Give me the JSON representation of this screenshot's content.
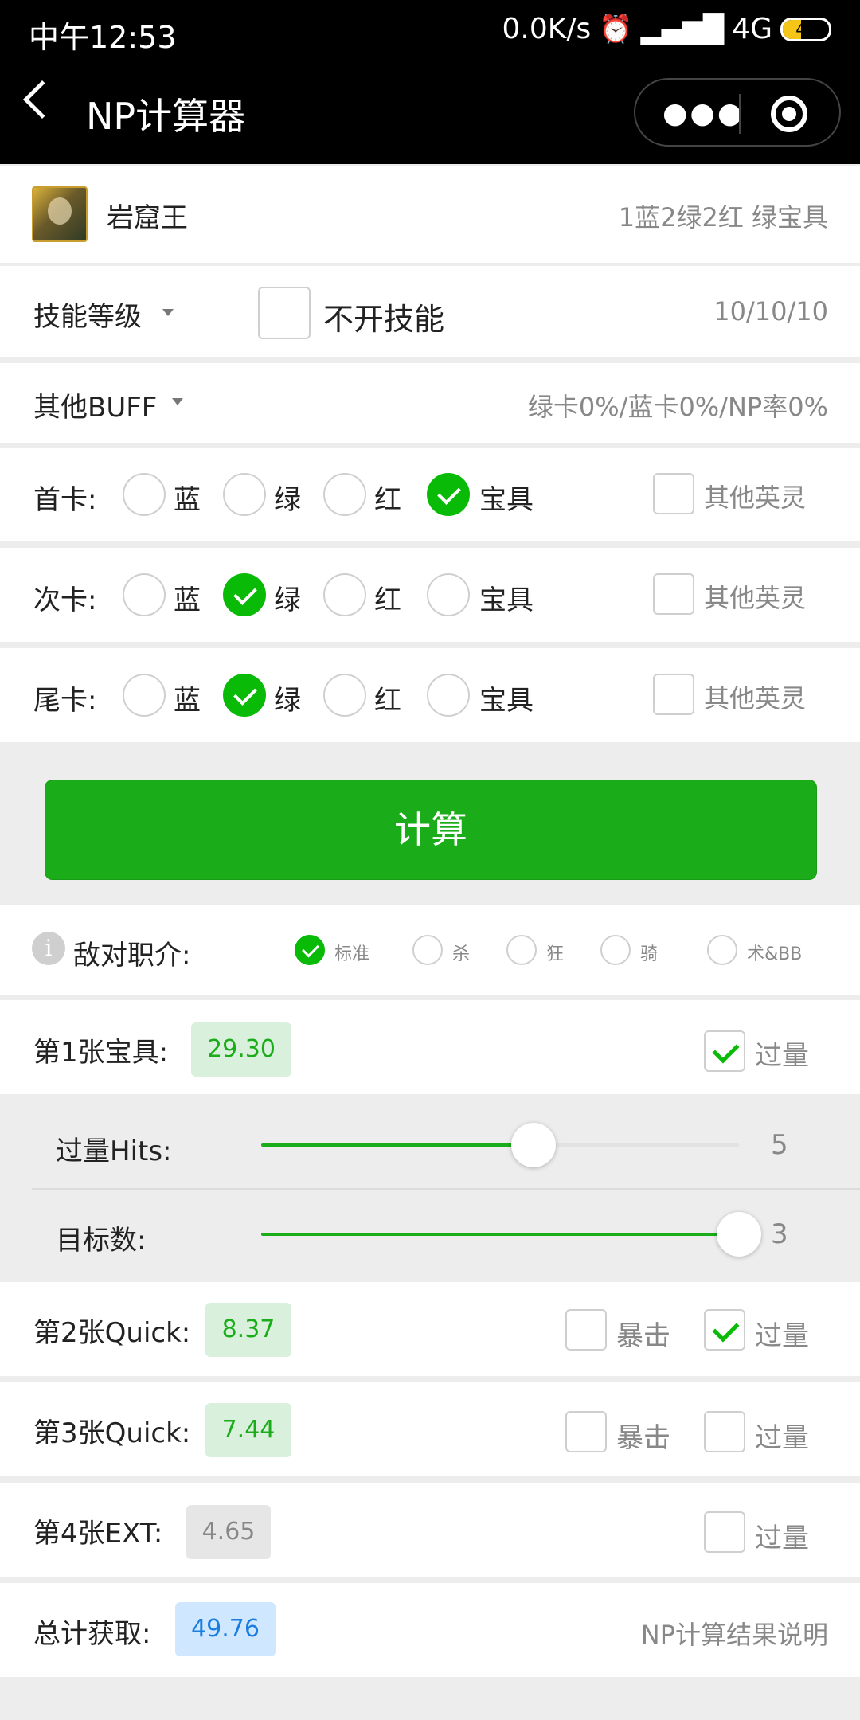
{
  "status": {
    "time": "中午12:53",
    "speed": "0.0K/s",
    "network": "4G",
    "battery": "40",
    "battery_level": 0.4
  },
  "nav": {
    "title": "NP计算器"
  },
  "servant": {
    "name": "岩窟王",
    "cards": "1蓝2绿2红 绿宝具"
  },
  "skill": {
    "label": "技能等级",
    "checkbox_label": "不开技能",
    "value": "10/10/10"
  },
  "buff": {
    "label": "其他BUFF",
    "value": "绿卡0%/蓝卡0%/NP率0%"
  },
  "card_rows": [
    {
      "label": "首卡:",
      "options": [
        "蓝",
        "绿",
        "红",
        "宝具"
      ],
      "selected": 3,
      "other_label": "其他英灵"
    },
    {
      "label": "次卡:",
      "options": [
        "蓝",
        "绿",
        "红",
        "宝具"
      ],
      "selected": 1,
      "other_label": "其他英灵"
    },
    {
      "label": "尾卡:",
      "options": [
        "蓝",
        "绿",
        "红",
        "宝具"
      ],
      "selected": 1,
      "other_label": "其他英灵"
    }
  ],
  "calc_button": "计算",
  "enemy": {
    "info_icon": "i",
    "label": "敌对职介:",
    "options": [
      "标准",
      "杀",
      "狂",
      "骑",
      "术&BB"
    ],
    "selected": 0
  },
  "results": {
    "np1": {
      "label": "第1张宝具:",
      "value": "29.30",
      "overkill_label": "过量",
      "overkill": true
    },
    "hits": {
      "label": "过量Hits:",
      "value": "5",
      "fraction": 0.57
    },
    "targets": {
      "label": "目标数:",
      "value": "3",
      "fraction": 1.0
    },
    "q2": {
      "label": "第2张Quick:",
      "value": "8.37",
      "crit_label": "暴击",
      "crit": false,
      "overkill_label": "过量",
      "overkill": true
    },
    "q3": {
      "label": "第3张Quick:",
      "value": "7.44",
      "crit_label": "暴击",
      "crit": false,
      "overkill_label": "过量",
      "overkill": false
    },
    "ext": {
      "label": "第4张EXT:",
      "value": "4.65",
      "overkill_label": "过量",
      "overkill": false
    },
    "total": {
      "label": "总计获取:",
      "value": "49.76",
      "link": "NP计算结果说明"
    }
  },
  "colors": {
    "accent": "#1aad19",
    "blue": "#1a7ee0"
  }
}
